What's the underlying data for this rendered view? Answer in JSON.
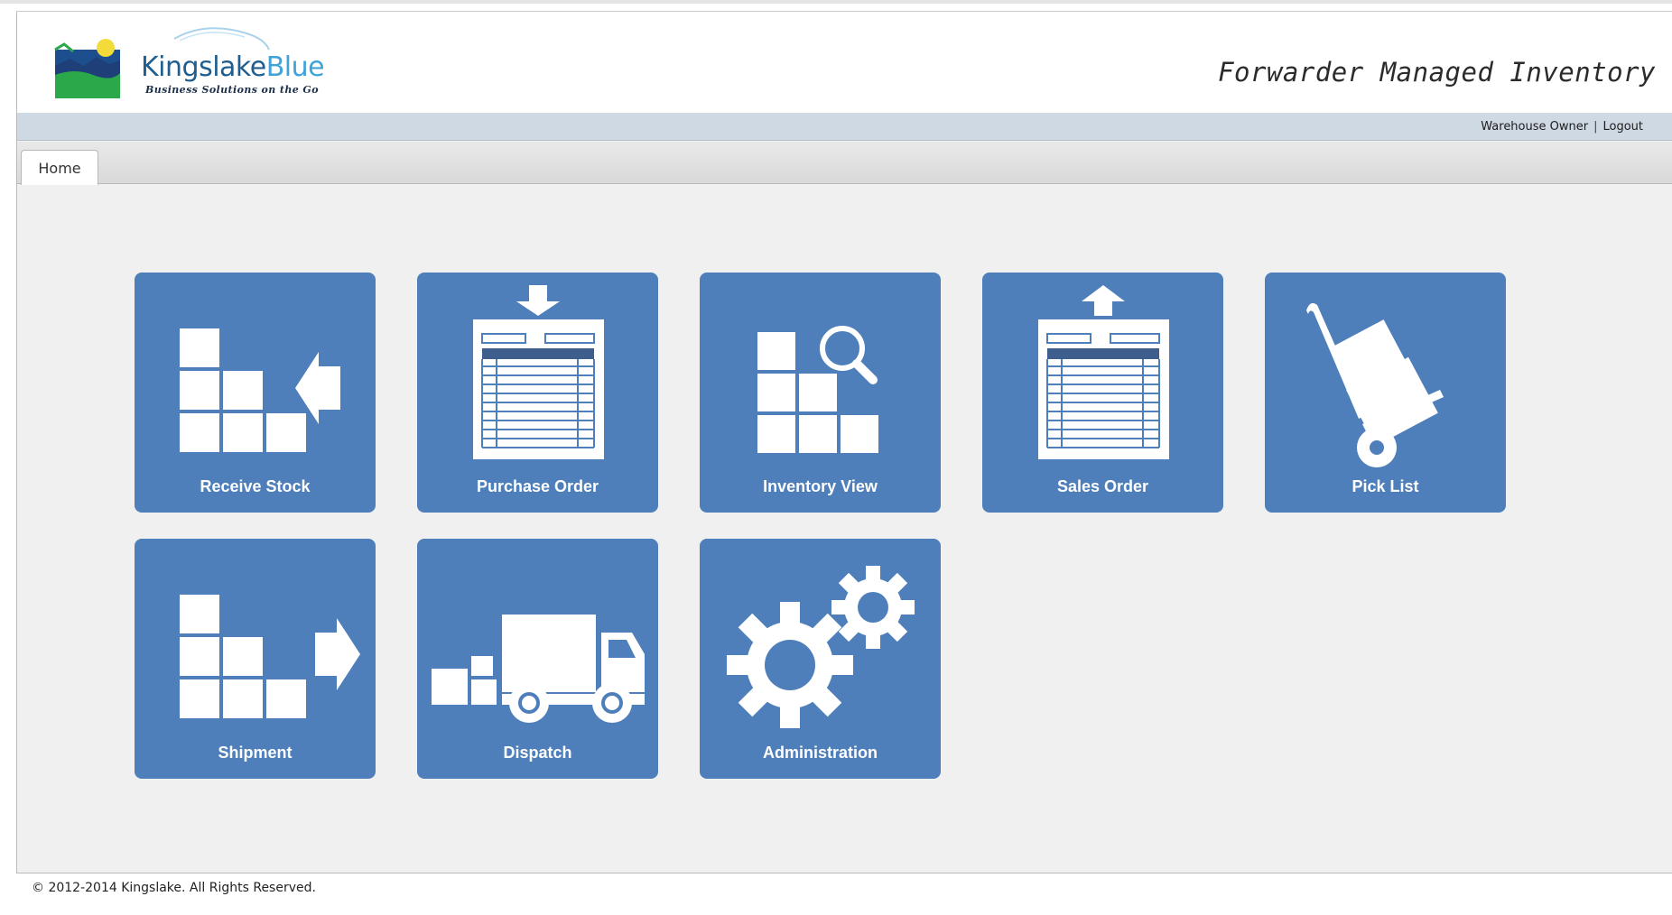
{
  "header": {
    "logo": {
      "name_part1": "Kingslake",
      "name_part2": "Blue",
      "tagline": "Business Solutions on the Go"
    },
    "app_title": "Forwarder Managed Inventory"
  },
  "userbar": {
    "user_label": "Warehouse Owner",
    "separator": "|",
    "logout_label": "Logout"
  },
  "tabs": [
    {
      "label": "Home"
    }
  ],
  "tiles": [
    {
      "label": "Receive Stock",
      "icon": "receive-stock-icon"
    },
    {
      "label": "Purchase Order",
      "icon": "purchase-order-icon"
    },
    {
      "label": "Inventory View",
      "icon": "inventory-view-icon"
    },
    {
      "label": "Sales Order",
      "icon": "sales-order-icon"
    },
    {
      "label": "Pick List",
      "icon": "hand-truck-icon"
    },
    {
      "label": "Shipment",
      "icon": "shipment-icon"
    },
    {
      "label": "Dispatch",
      "icon": "truck-icon"
    },
    {
      "label": "Administration",
      "icon": "gears-icon"
    }
  ],
  "colors": {
    "tile": "#4e7fba",
    "userbar": "#cfd9e3",
    "background": "#f0f0f0"
  },
  "footer": {
    "copyright": "© 2012-2014 Kingslake. All Rights Reserved."
  }
}
